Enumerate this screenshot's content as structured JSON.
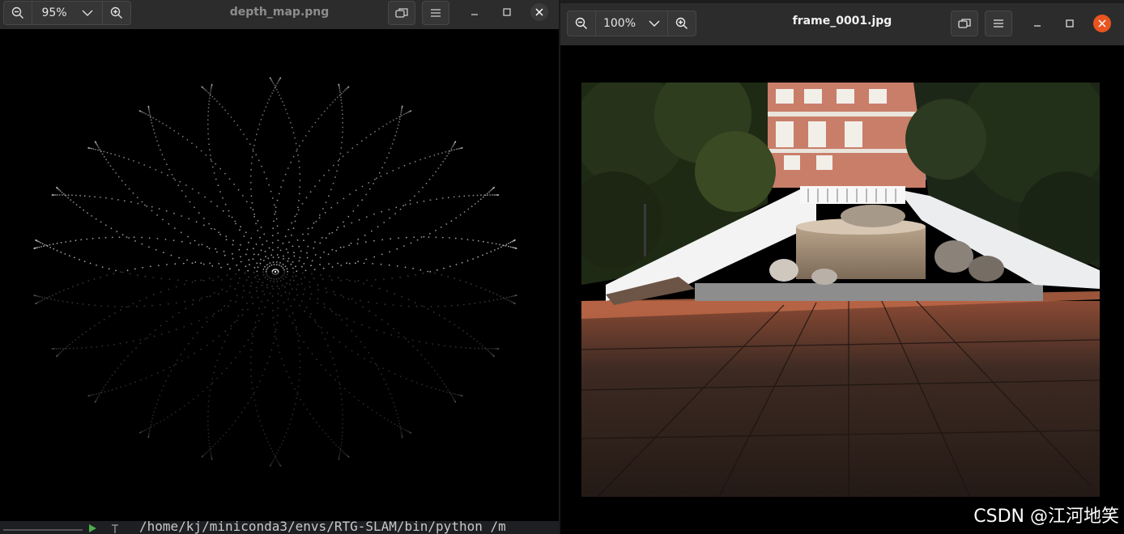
{
  "left_viewer": {
    "zoom_out_icon": "zoom-out-icon",
    "zoom_level": "95%",
    "zoom_dropdown_icon": "chevron-down-icon",
    "zoom_in_icon": "zoom-in-icon",
    "title": "depth_map.png",
    "fullscreen_icon": "restore-icon",
    "menu_icon": "hamburger-menu-icon",
    "minimize_icon": "minimize-icon",
    "maximize_icon": "maximize-icon",
    "close_icon": "close-icon",
    "close_color": "#3a3a3a",
    "image": "depth map point pattern"
  },
  "right_viewer": {
    "zoom_out_icon": "zoom-out-icon",
    "zoom_level": "100%",
    "zoom_dropdown_icon": "chevron-down-icon",
    "zoom_in_icon": "zoom-in-icon",
    "title": "frame_0001.jpg",
    "fullscreen_icon": "restore-icon",
    "menu_icon": "hamburger-menu-icon",
    "minimize_icon": "minimize-icon",
    "maximize_icon": "maximize-icon",
    "close_icon": "close-icon",
    "close_color": "#e95420",
    "image": "photo of staircase and plaza"
  },
  "terminal": {
    "command": "/home/kj/miniconda3/envs/RTG-SLAM/bin/python /m"
  },
  "watermark": "CSDN @江河地笑"
}
